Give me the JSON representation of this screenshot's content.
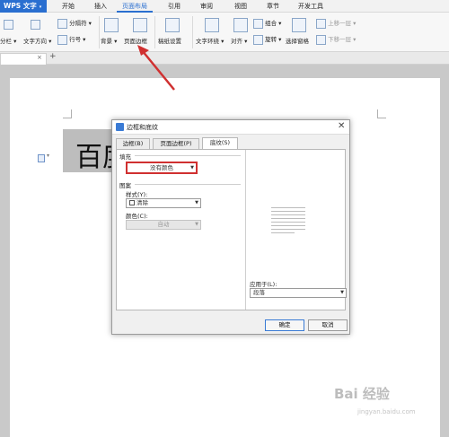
{
  "menubar": {
    "app_button": "WPS 文字",
    "tabs": [
      "开始",
      "插入",
      "页面布局",
      "引用",
      "审阅",
      "视图",
      "章节",
      "开发工具"
    ],
    "active_tab": "页面布局"
  },
  "ribbon": {
    "columns": "分栏",
    "text_direction": "文字方向",
    "separator": "分隔符",
    "line_number": "行号",
    "background": "背景",
    "page_border": "页面边框",
    "paper_settings": "稿纸设置",
    "text_wrap": "文字环绕",
    "align": "对齐",
    "group": "组合",
    "rotate": "旋转",
    "selection_pane": "选择窗格",
    "bring_forward": "上移一层",
    "send_backward": "下移一层"
  },
  "tabbar": {
    "close": "×",
    "new_tab": "+"
  },
  "document": {
    "text": "百度"
  },
  "dialog": {
    "title": "边框和底纹",
    "close": "✕",
    "tabs": [
      "边框(B)",
      "页面边框(P)",
      "底纹(S)"
    ],
    "active_tab": "底纹(S)",
    "fill": {
      "label": "填充",
      "value": "没有颜色"
    },
    "pattern": {
      "label": "图案",
      "style_label": "样式(Y):",
      "style_value": "清除",
      "color_label": "颜色(C):",
      "color_value": "自动"
    },
    "preview": {
      "label": "预览"
    },
    "apply_to": {
      "label": "应用于(L):",
      "value": "段落"
    },
    "ok": "确定",
    "cancel": "取消"
  },
  "watermark": {
    "text": "Bai 经验",
    "sub": "jingyan.baidu.com"
  },
  "colors": {
    "accent": "#2a6fd0",
    "highlight": "#d03030"
  }
}
